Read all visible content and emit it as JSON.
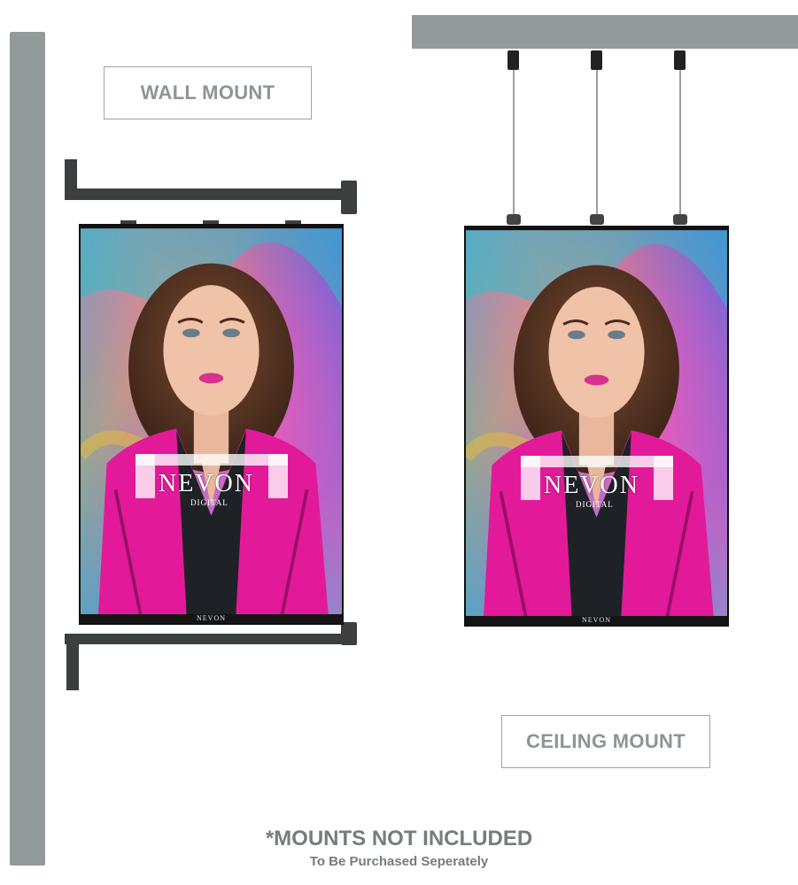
{
  "labels": {
    "wall_mount": "WALL MOUNT",
    "ceiling_mount": "CEILING MOUNT"
  },
  "screen": {
    "brand": "NEVON",
    "brand_sub": "DIGITAL",
    "footer_brand": "NEVON"
  },
  "footer": {
    "note": "*MOUNTS NOT INCLUDED",
    "subnote": "To Be Purchased Seperately"
  },
  "colors": {
    "wall": "#939a9a",
    "bracket": "#3b3f40",
    "label_text": "#8f9494",
    "jacket": "#e21a9a"
  }
}
